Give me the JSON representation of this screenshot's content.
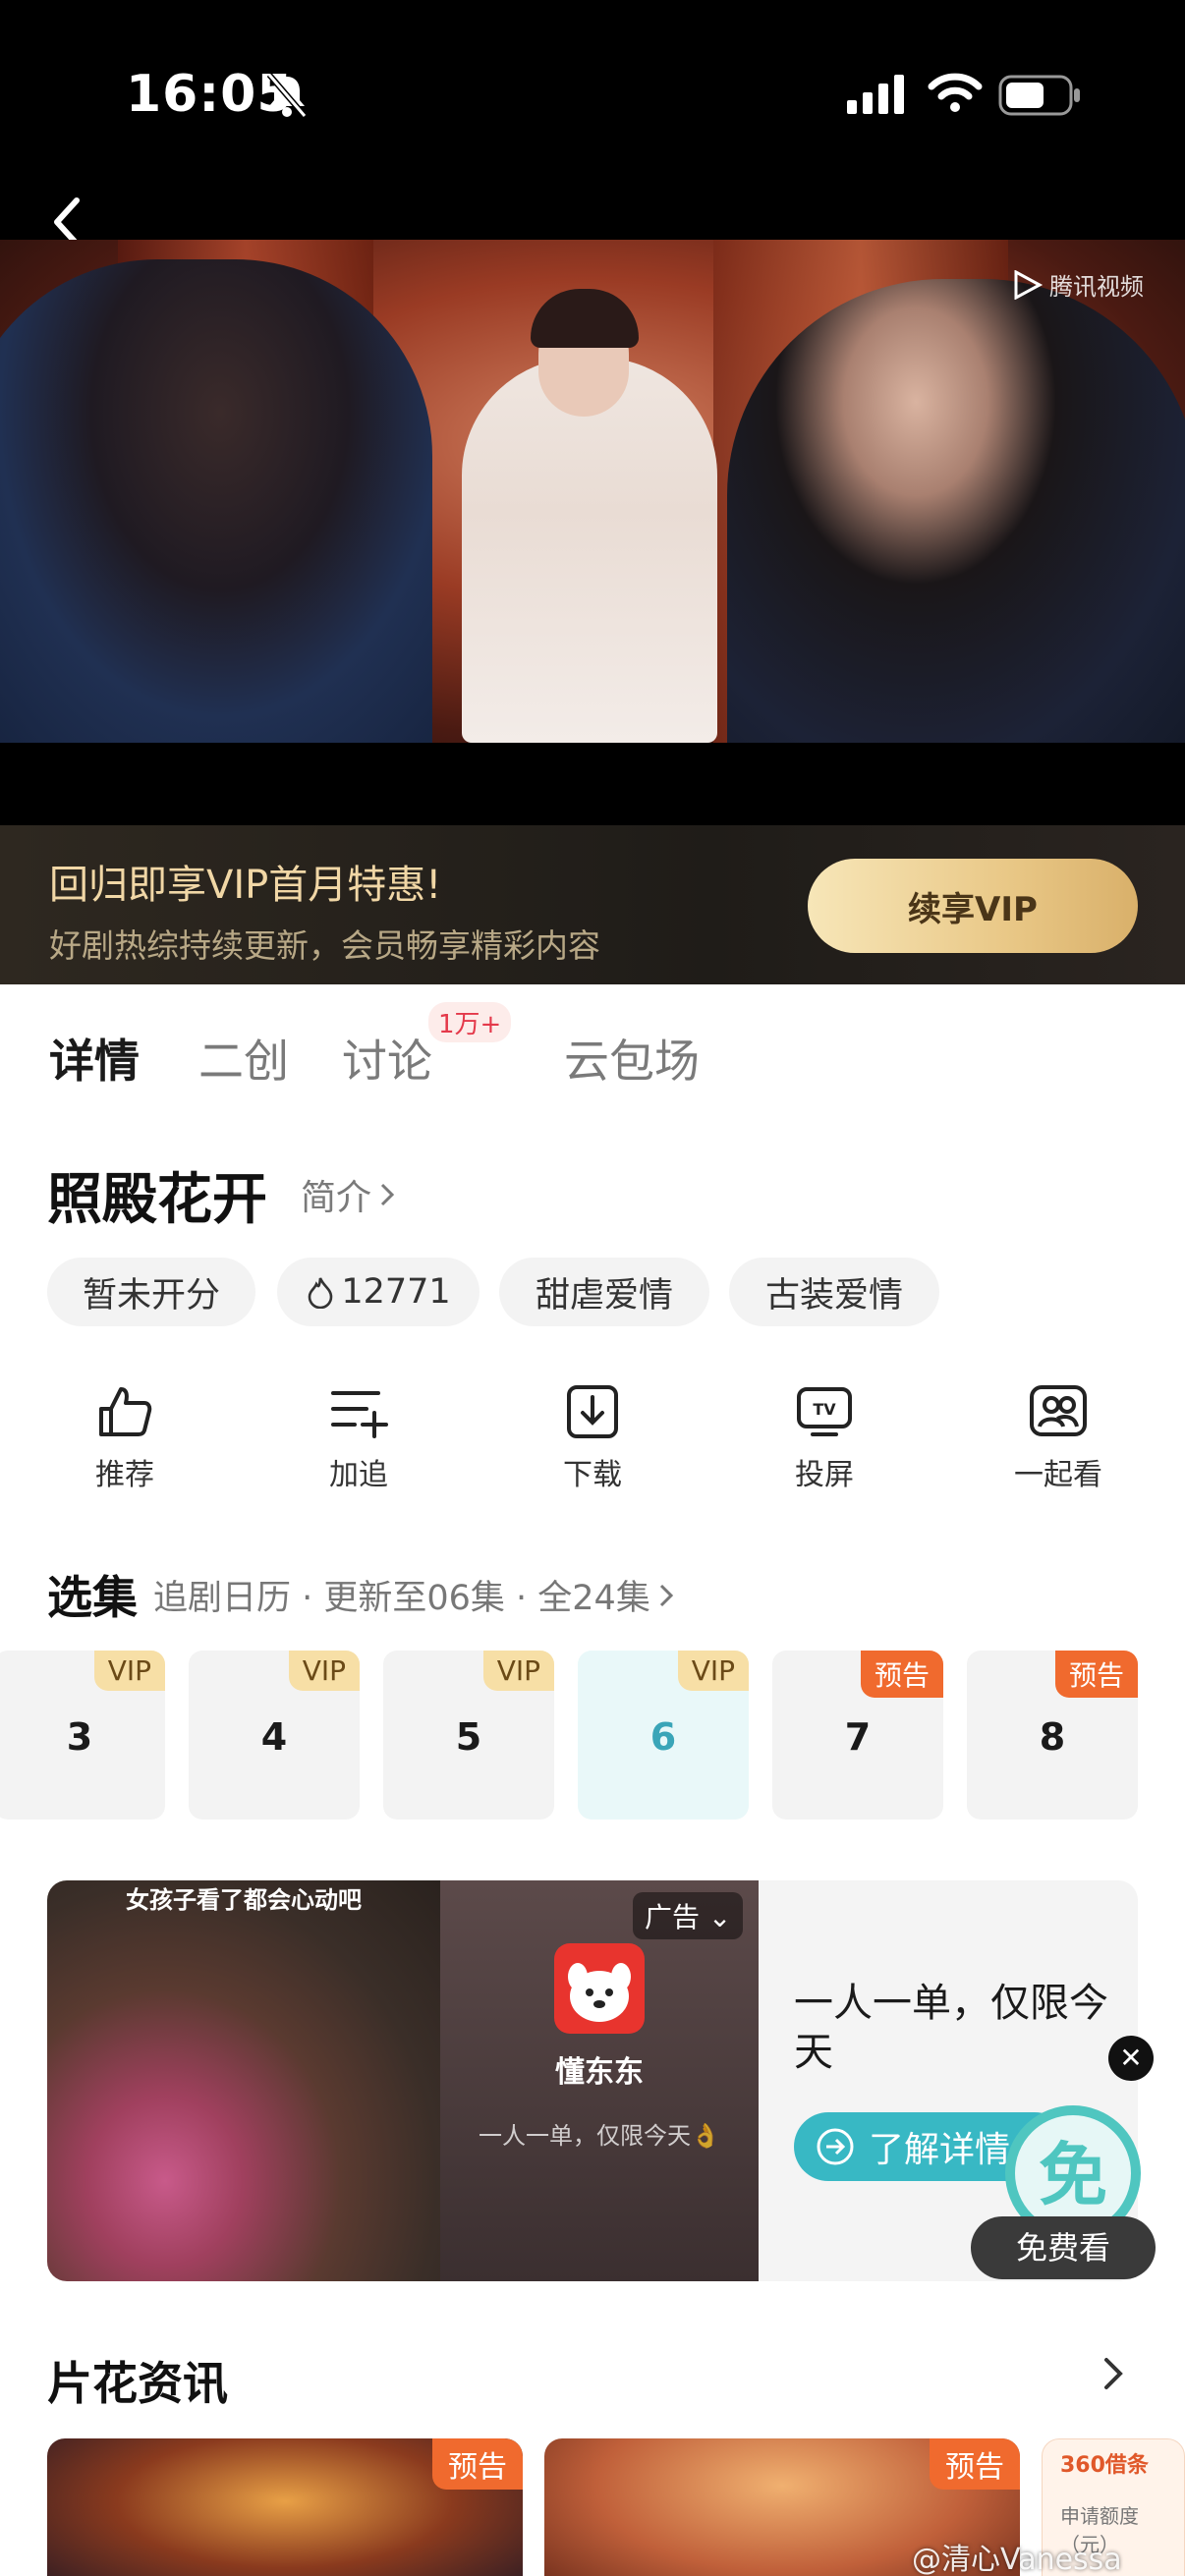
{
  "status": {
    "time": "16:05"
  },
  "player": {
    "watermark": "腾讯视频"
  },
  "vip_banner": {
    "title": "回归即享VIP首月特惠!",
    "subtitle": "好剧热综持续更新，会员畅享精彩内容",
    "button": "续享VIP"
  },
  "tabs": [
    {
      "label": "详情",
      "active": true
    },
    {
      "label": "二创"
    },
    {
      "label": "讨论",
      "badge": "1万+"
    },
    {
      "label": "云包场"
    }
  ],
  "show": {
    "title": "照殿花开",
    "intro": "简介",
    "chips": [
      "暂未开分",
      "12771",
      "甜虐爱情",
      "古装爱情"
    ]
  },
  "actions": [
    {
      "label": "推荐",
      "icon": "thumbs-up-icon"
    },
    {
      "label": "加追",
      "icon": "add-list-icon"
    },
    {
      "label": "下载",
      "icon": "download-icon"
    },
    {
      "label": "投屏",
      "icon": "tv-cast-icon"
    },
    {
      "label": "一起看",
      "icon": "watch-together-icon"
    }
  ],
  "episodes": {
    "title": "选集",
    "subtitle": "追剧日历 · 更新至06集 · 全24集",
    "items": [
      {
        "num": "3",
        "tag": "VIP"
      },
      {
        "num": "4",
        "tag": "VIP"
      },
      {
        "num": "5",
        "tag": "VIP"
      },
      {
        "num": "6",
        "tag": "VIP",
        "current": true
      },
      {
        "num": "7",
        "tag": "预告"
      },
      {
        "num": "8",
        "tag": "预告"
      }
    ]
  },
  "ad": {
    "photo_caption": "女孩子看了都会心动吧",
    "tag": "广告",
    "brand": "懂东东",
    "brand_desc": "一人一单，仅限今天👌",
    "headline": "一人一单，仅限今天",
    "cta": "了解详情",
    "free_label": "免费看",
    "free_badge": "免"
  },
  "clips": {
    "title": "片花资讯",
    "items": [
      {
        "tag": "预告"
      },
      {
        "tag": "预告"
      }
    ],
    "side_ad_brand": "360借条",
    "side_ad_text": "申请额度（元）"
  },
  "weibo_mark": "@清心Vanessa"
}
